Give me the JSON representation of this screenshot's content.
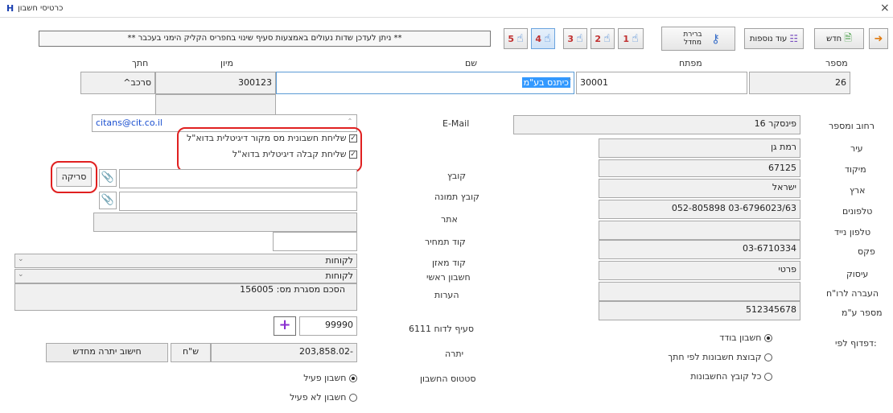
{
  "window": {
    "title": "כרטיסי חשבון",
    "close_glyph": "×"
  },
  "toolbar": {
    "new_label": "חדש",
    "more_label": "עוד נוספות",
    "default_label": "ברירת מחדל",
    "notice": "** ניתן לעדכן שדות נעולים באמצעות סעיף שינוי בחפריס הקליק הימני בעכבר **",
    "number_buttons": [
      "1",
      "2",
      "3",
      "4",
      "5"
    ]
  },
  "header": {
    "labels": {
      "number": "מספר",
      "key": "מפתח",
      "name": "שם",
      "sort": "מיון",
      "branch": "חתך"
    },
    "values": {
      "number": "26",
      "key": "30001",
      "name": "כיתנס בע\"מ",
      "sort": "300123",
      "branch": "סרכב^"
    }
  },
  "left": {
    "email_label": "E-Mail",
    "email_value": "citans@cit.co.il",
    "check_tax": "שליחת חשבונית מס מקור דיגיטלית בדוא\"ל",
    "check_receipt": "שליחת קבלה דיגיטלית בדוא\"ל",
    "file_label": "קובץ",
    "scan_button": "סריקה",
    "image_label": "קובץ תמונה",
    "site_label": "אתר",
    "price_label": "קוד תמחיר",
    "index_label": "קוד מאזן",
    "index_value": "לקוחות",
    "main_label": "חשבון ראשי",
    "main_value": "לקוחות",
    "notes_label": "הערות",
    "notes_value": "הסכם מסגרת מס: 156005",
    "section_label": "סעיף לדוח 6111",
    "section_value": "99990",
    "add_glyph": "+",
    "balance_label": "יתרה",
    "balance_value": "-203,858.02",
    "currency": "ש\"ח",
    "recalc_button": "חישוב יתרה מחדש",
    "status_label": "סטטוס החשבון",
    "status_active": "חשבון פעיל",
    "status_inactive": "חשבון לא פעיל"
  },
  "right": {
    "street_label": "רחוב ומספר",
    "street_value": "פינסקר 16",
    "city_label": "עיר",
    "city_value": "רמת גן",
    "zip_label": "מיקוד",
    "zip_value": "67125",
    "country_label": "ארץ",
    "country_value": "ישראל",
    "phones_label": "טלפונים",
    "phones_value": "03-6796023/63  052-805898",
    "mobile_label": "טלפון נייד",
    "mobile_value": "",
    "fax_label": "פקס",
    "fax_value": "03-6710334",
    "business_label": "עיסוק",
    "business_value": "פרטי",
    "transfer_label": "העברה לרו\"ח",
    "transfer_value": "",
    "vat_label": "מספר ע\"מ",
    "vat_value": "512345678",
    "paging_label": "דפדוף לפי:",
    "radio_single": "חשבון בודד",
    "radio_group": "קבוצת חשבונות לפי חתך",
    "radio_all": "כל קובץ החשבונות"
  }
}
